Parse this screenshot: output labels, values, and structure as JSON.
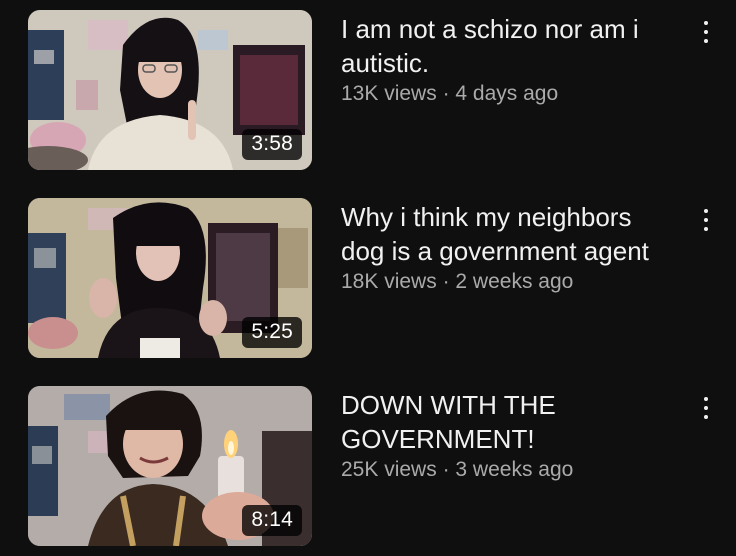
{
  "videos": [
    {
      "title": "I am not a schizo nor am i autistic.",
      "views": "13K views",
      "separator": "·",
      "age": "4 days ago",
      "duration": "3:58"
    },
    {
      "title": "Why i think my neighbors dog is a government agent",
      "views": "18K views",
      "separator": "·",
      "age": "2 weeks ago",
      "duration": "5:25"
    },
    {
      "title": "DOWN WITH THE GOVERNMENT!",
      "views": "25K views",
      "separator": "·",
      "age": "3 weeks ago",
      "duration": "8:14"
    }
  ],
  "icons": {
    "menu": "more-vert-icon"
  },
  "colors": {
    "background": "#0f0f0f",
    "title": "#f1f1f1",
    "stats": "#aaaaaa"
  }
}
